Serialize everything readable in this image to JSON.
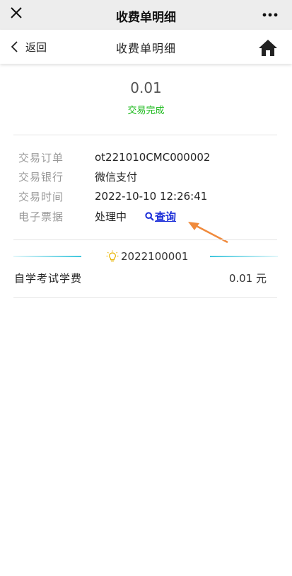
{
  "wechat_bar": {
    "title": "收费单明细"
  },
  "nav": {
    "back_label": "返回",
    "title": "收费单明细"
  },
  "summary": {
    "amount": "0.01",
    "status": "交易完成",
    "status_color": "#1cba1c"
  },
  "details": [
    {
      "label": "交易订单",
      "value": "ot221010CMC000002"
    },
    {
      "label": "交易银行",
      "value": "微信支付"
    },
    {
      "label": "交易时间",
      "value": "2022-10-10 12:26:41"
    },
    {
      "label": "电子票据",
      "value": "处理中"
    }
  ],
  "query_link": {
    "label": "查询",
    "icon": "search-icon",
    "color": "#1a2dd8"
  },
  "bill": {
    "number": "2022100001",
    "icon": "lightbulb-icon",
    "items": [
      {
        "name": "自学考试学费",
        "amount": "0.01 元"
      }
    ]
  }
}
